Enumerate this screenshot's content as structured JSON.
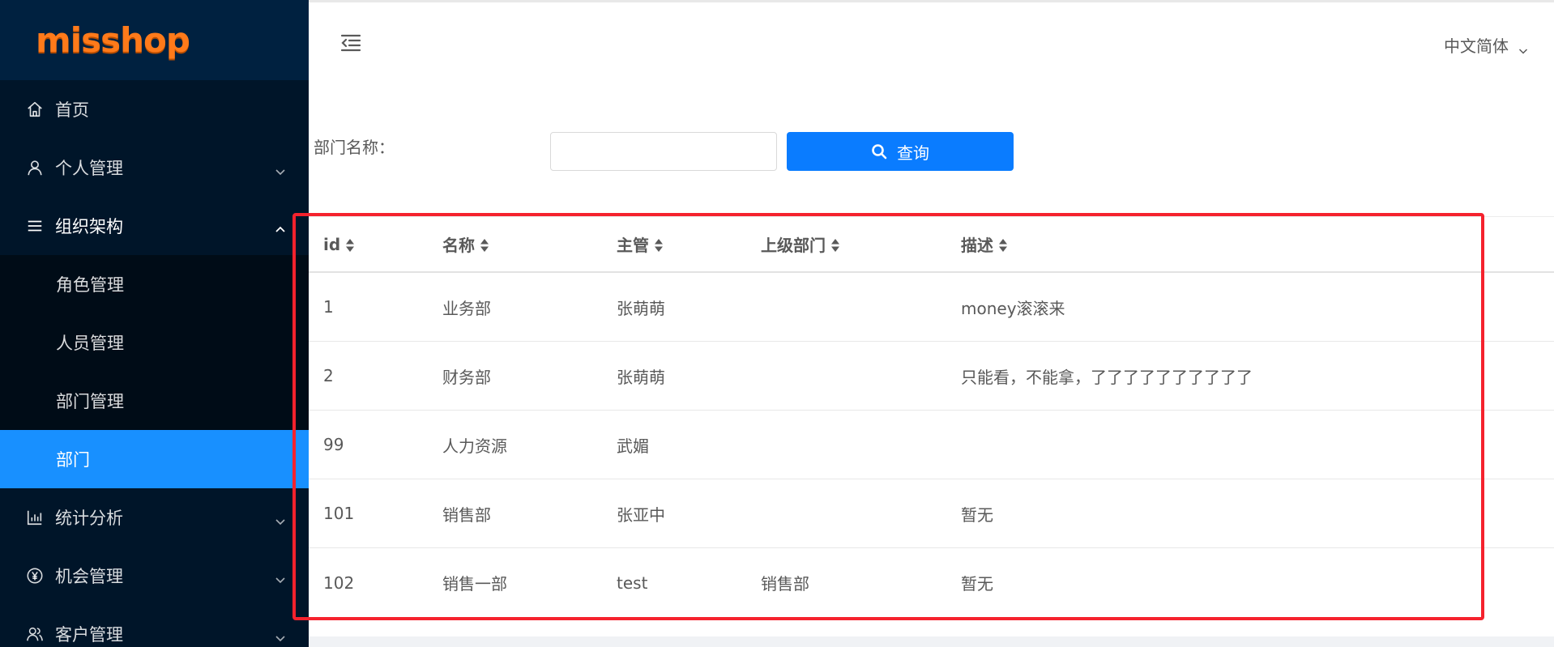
{
  "brand": {
    "logo_text": "misshop",
    "logo_color": "#ff7a1a"
  },
  "colors": {
    "sidebar_bg": "#001529",
    "submenu_bg": "#000c17",
    "active": "#1890ff",
    "primary_button": "#0a7cff",
    "highlight_border": "#f5222d"
  },
  "sidebar": {
    "items": [
      {
        "label": "首页",
        "icon": "home-icon"
      },
      {
        "label": "个人管理",
        "icon": "user-icon",
        "expandable": true
      },
      {
        "label": "组织架构",
        "icon": "menu-lines-icon",
        "expandable": true,
        "open": true
      },
      {
        "label": "统计分析",
        "icon": "bar-chart-icon",
        "expandable": true
      },
      {
        "label": "机会管理",
        "icon": "yen-circle-icon",
        "expandable": true
      },
      {
        "label": "客户管理",
        "icon": "team-icon",
        "expandable": true
      }
    ],
    "submenu": [
      {
        "label": "角色管理"
      },
      {
        "label": "人员管理"
      },
      {
        "label": "部门管理"
      },
      {
        "label": "部门",
        "active": true
      }
    ]
  },
  "header": {
    "toggle_icon": "menu-fold-icon",
    "language": "中文简体"
  },
  "search": {
    "label": "部门名称：",
    "input_value": "",
    "placeholder": "",
    "button_label": "查询",
    "button_icon": "search-icon"
  },
  "table": {
    "columns": [
      "id",
      "名称",
      "主管",
      "上级部门",
      "描述"
    ],
    "rows": [
      [
        "1",
        "业务部",
        "张萌萌",
        "",
        "money滚滚来"
      ],
      [
        "2",
        "财务部",
        "张萌萌",
        "",
        "只能看，不能拿，了了了了了了了了了了"
      ],
      [
        "99",
        "人力资源",
        "武媚",
        "",
        ""
      ],
      [
        "101",
        "销售部",
        "张亚中",
        "",
        "暂无"
      ],
      [
        "102",
        "销售一部",
        "test",
        "销售部",
        "暂无"
      ]
    ]
  }
}
